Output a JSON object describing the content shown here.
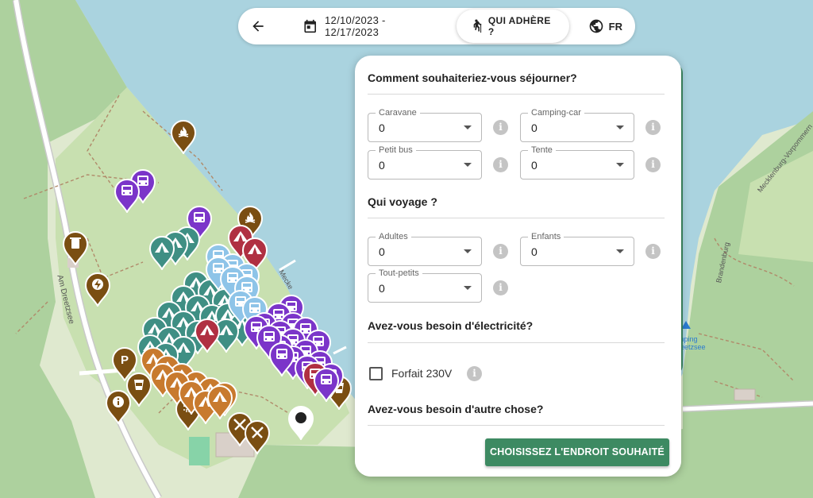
{
  "topbar": {
    "back_icon": "arrow-left-icon",
    "date_icon": "calendar-icon",
    "date_range": "12/10/2023 - 12/17/2023",
    "who_icon": "hiker-icon",
    "who_label": "QUI ADHÈRE ?",
    "lang_icon": "globe-icon",
    "lang_label": "FR"
  },
  "panel": {
    "stay_title": "Comment souhaiteriez-vous séjourner?",
    "stay_fields": [
      {
        "label": "Caravane",
        "value": "0"
      },
      {
        "label": "Camping-car",
        "value": "0"
      },
      {
        "label": "Petit bus",
        "value": "0"
      },
      {
        "label": "Tente",
        "value": "0"
      }
    ],
    "travel_title": "Qui voyage ?",
    "travel_fields": [
      {
        "label": "Adultes",
        "value": "0"
      },
      {
        "label": "Enfants",
        "value": "0"
      },
      {
        "label": "Tout-petits",
        "value": "0"
      }
    ],
    "electricity_title": "Avez-vous besoin d'électricité?",
    "electricity_option": "Forfait 230V",
    "electricity_checked": false,
    "other_title": "Avez-vous besoin d'autre chose?",
    "cta_label": "CHOISISSEZ L'ENDROIT SOUHAITÉ",
    "info_glyph": "i"
  },
  "map": {
    "streets": [
      "Am Dreetzsee",
      "Mecklenburg-Vorpommern",
      "Brandenburg",
      "Mecke"
    ],
    "camp_label": "mping\nreetzsee",
    "colors": {
      "water": "#aad3df",
      "land": "#dfe9cf",
      "forest": "#add19e",
      "road": "#ffffff",
      "pin_brown": "#7a4e12",
      "pin_purple": "#7b35c9",
      "pin_teal": "#3f8f84",
      "pin_lightblue": "#8ec4e8",
      "pin_red": "#b03042",
      "pin_orange": "#c87a2e"
    }
  },
  "colors": {
    "accent": "#3d8a62"
  }
}
